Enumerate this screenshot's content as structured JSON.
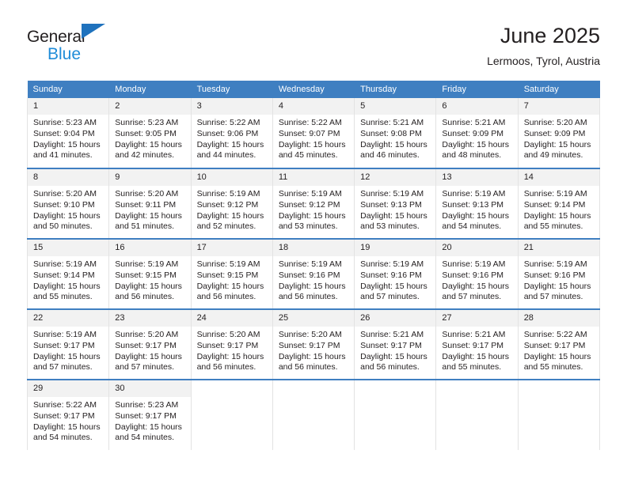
{
  "brand": {
    "line1": "General",
    "line2": "Blue",
    "triangle_color": "#1f72bd",
    "blue_text_color": "#1f8cd8"
  },
  "header": {
    "title": "June 2025",
    "subtitle": "Lermoos, Tyrol, Austria"
  },
  "theme": {
    "header_bg": "#3f7fc1",
    "daynum_bg": "#f2f2f2",
    "grid_line": "#e3e3e3",
    "text": "#231f20"
  },
  "columns": [
    "Sunday",
    "Tuesday",
    "Monday",
    "Wednesday",
    "Thursday",
    "Friday",
    "Saturday"
  ],
  "weekday_headers": [
    "Sunday",
    "Monday",
    "Tuesday",
    "Wednesday",
    "Thursday",
    "Friday",
    "Saturday"
  ],
  "labels": {
    "sunrise": "Sunrise:",
    "sunset": "Sunset:",
    "daylight": "Daylight:"
  },
  "weeks": [
    [
      {
        "day": "1",
        "sunrise": "Sunrise: 5:23 AM",
        "sunset": "Sunset: 9:04 PM",
        "daylight1": "Daylight: 15 hours",
        "daylight2": "and 41 minutes."
      },
      {
        "day": "2",
        "sunrise": "Sunrise: 5:23 AM",
        "sunset": "Sunset: 9:05 PM",
        "daylight1": "Daylight: 15 hours",
        "daylight2": "and 42 minutes."
      },
      {
        "day": "3",
        "sunrise": "Sunrise: 5:22 AM",
        "sunset": "Sunset: 9:06 PM",
        "daylight1": "Daylight: 15 hours",
        "daylight2": "and 44 minutes."
      },
      {
        "day": "4",
        "sunrise": "Sunrise: 5:22 AM",
        "sunset": "Sunset: 9:07 PM",
        "daylight1": "Daylight: 15 hours",
        "daylight2": "and 45 minutes."
      },
      {
        "day": "5",
        "sunrise": "Sunrise: 5:21 AM",
        "sunset": "Sunset: 9:08 PM",
        "daylight1": "Daylight: 15 hours",
        "daylight2": "and 46 minutes."
      },
      {
        "day": "6",
        "sunrise": "Sunrise: 5:21 AM",
        "sunset": "Sunset: 9:09 PM",
        "daylight1": "Daylight: 15 hours",
        "daylight2": "and 48 minutes."
      },
      {
        "day": "7",
        "sunrise": "Sunrise: 5:20 AM",
        "sunset": "Sunset: 9:09 PM",
        "daylight1": "Daylight: 15 hours",
        "daylight2": "and 49 minutes."
      }
    ],
    [
      {
        "day": "8",
        "sunrise": "Sunrise: 5:20 AM",
        "sunset": "Sunset: 9:10 PM",
        "daylight1": "Daylight: 15 hours",
        "daylight2": "and 50 minutes."
      },
      {
        "day": "9",
        "sunrise": "Sunrise: 5:20 AM",
        "sunset": "Sunset: 9:11 PM",
        "daylight1": "Daylight: 15 hours",
        "daylight2": "and 51 minutes."
      },
      {
        "day": "10",
        "sunrise": "Sunrise: 5:19 AM",
        "sunset": "Sunset: 9:12 PM",
        "daylight1": "Daylight: 15 hours",
        "daylight2": "and 52 minutes."
      },
      {
        "day": "11",
        "sunrise": "Sunrise: 5:19 AM",
        "sunset": "Sunset: 9:12 PM",
        "daylight1": "Daylight: 15 hours",
        "daylight2": "and 53 minutes."
      },
      {
        "day": "12",
        "sunrise": "Sunrise: 5:19 AM",
        "sunset": "Sunset: 9:13 PM",
        "daylight1": "Daylight: 15 hours",
        "daylight2": "and 53 minutes."
      },
      {
        "day": "13",
        "sunrise": "Sunrise: 5:19 AM",
        "sunset": "Sunset: 9:13 PM",
        "daylight1": "Daylight: 15 hours",
        "daylight2": "and 54 minutes."
      },
      {
        "day": "14",
        "sunrise": "Sunrise: 5:19 AM",
        "sunset": "Sunset: 9:14 PM",
        "daylight1": "Daylight: 15 hours",
        "daylight2": "and 55 minutes."
      }
    ],
    [
      {
        "day": "15",
        "sunrise": "Sunrise: 5:19 AM",
        "sunset": "Sunset: 9:14 PM",
        "daylight1": "Daylight: 15 hours",
        "daylight2": "and 55 minutes."
      },
      {
        "day": "16",
        "sunrise": "Sunrise: 5:19 AM",
        "sunset": "Sunset: 9:15 PM",
        "daylight1": "Daylight: 15 hours",
        "daylight2": "and 56 minutes."
      },
      {
        "day": "17",
        "sunrise": "Sunrise: 5:19 AM",
        "sunset": "Sunset: 9:15 PM",
        "daylight1": "Daylight: 15 hours",
        "daylight2": "and 56 minutes."
      },
      {
        "day": "18",
        "sunrise": "Sunrise: 5:19 AM",
        "sunset": "Sunset: 9:16 PM",
        "daylight1": "Daylight: 15 hours",
        "daylight2": "and 56 minutes."
      },
      {
        "day": "19",
        "sunrise": "Sunrise: 5:19 AM",
        "sunset": "Sunset: 9:16 PM",
        "daylight1": "Daylight: 15 hours",
        "daylight2": "and 57 minutes."
      },
      {
        "day": "20",
        "sunrise": "Sunrise: 5:19 AM",
        "sunset": "Sunset: 9:16 PM",
        "daylight1": "Daylight: 15 hours",
        "daylight2": "and 57 minutes."
      },
      {
        "day": "21",
        "sunrise": "Sunrise: 5:19 AM",
        "sunset": "Sunset: 9:16 PM",
        "daylight1": "Daylight: 15 hours",
        "daylight2": "and 57 minutes."
      }
    ],
    [
      {
        "day": "22",
        "sunrise": "Sunrise: 5:19 AM",
        "sunset": "Sunset: 9:17 PM",
        "daylight1": "Daylight: 15 hours",
        "daylight2": "and 57 minutes."
      },
      {
        "day": "23",
        "sunrise": "Sunrise: 5:20 AM",
        "sunset": "Sunset: 9:17 PM",
        "daylight1": "Daylight: 15 hours",
        "daylight2": "and 57 minutes."
      },
      {
        "day": "24",
        "sunrise": "Sunrise: 5:20 AM",
        "sunset": "Sunset: 9:17 PM",
        "daylight1": "Daylight: 15 hours",
        "daylight2": "and 56 minutes."
      },
      {
        "day": "25",
        "sunrise": "Sunrise: 5:20 AM",
        "sunset": "Sunset: 9:17 PM",
        "daylight1": "Daylight: 15 hours",
        "daylight2": "and 56 minutes."
      },
      {
        "day": "26",
        "sunrise": "Sunrise: 5:21 AM",
        "sunset": "Sunset: 9:17 PM",
        "daylight1": "Daylight: 15 hours",
        "daylight2": "and 56 minutes."
      },
      {
        "day": "27",
        "sunrise": "Sunrise: 5:21 AM",
        "sunset": "Sunset: 9:17 PM",
        "daylight1": "Daylight: 15 hours",
        "daylight2": "and 55 minutes."
      },
      {
        "day": "28",
        "sunrise": "Sunrise: 5:22 AM",
        "sunset": "Sunset: 9:17 PM",
        "daylight1": "Daylight: 15 hours",
        "daylight2": "and 55 minutes."
      }
    ],
    [
      {
        "day": "29",
        "sunrise": "Sunrise: 5:22 AM",
        "sunset": "Sunset: 9:17 PM",
        "daylight1": "Daylight: 15 hours",
        "daylight2": "and 54 minutes."
      },
      {
        "day": "30",
        "sunrise": "Sunrise: 5:23 AM",
        "sunset": "Sunset: 9:17 PM",
        "daylight1": "Daylight: 15 hours",
        "daylight2": "and 54 minutes."
      },
      {
        "day": "",
        "sunrise": "",
        "sunset": "",
        "daylight1": "",
        "daylight2": ""
      },
      {
        "day": "",
        "sunrise": "",
        "sunset": "",
        "daylight1": "",
        "daylight2": ""
      },
      {
        "day": "",
        "sunrise": "",
        "sunset": "",
        "daylight1": "",
        "daylight2": ""
      },
      {
        "day": "",
        "sunrise": "",
        "sunset": "",
        "daylight1": "",
        "daylight2": ""
      },
      {
        "day": "",
        "sunrise": "",
        "sunset": "",
        "daylight1": "",
        "daylight2": ""
      }
    ]
  ]
}
